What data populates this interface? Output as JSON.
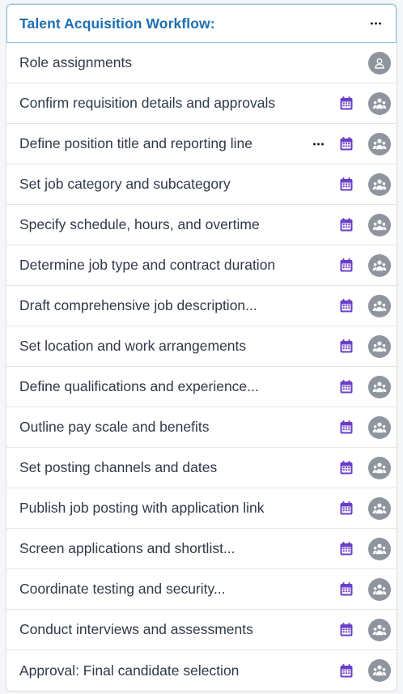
{
  "workflow": {
    "title": "Talent Acquisition Workflow:",
    "role_assignments_label": "Role assignments",
    "steps": [
      {
        "label": "Confirm requisition details and approvals"
      },
      {
        "label": "Define position title and reporting line",
        "more_menu": true
      },
      {
        "label": "Set job category and subcategory"
      },
      {
        "label": "Specify schedule, hours, and overtime"
      },
      {
        "label": "Determine job type and contract duration"
      },
      {
        "label": "Draft comprehensive job description..."
      },
      {
        "label": "Set location and work arrangements"
      },
      {
        "label": "Define qualifications and experience..."
      },
      {
        "label": "Outline pay scale and benefits"
      },
      {
        "label": "Set posting channels and dates"
      },
      {
        "label": "Publish job posting with application link"
      },
      {
        "label": "Screen applications and shortlist..."
      },
      {
        "label": "Coordinate testing and security..."
      },
      {
        "label": "Conduct interviews and assessments"
      },
      {
        "label": "Approval: Final candidate selection"
      }
    ]
  },
  "icons": {
    "header_menu": "more-horizontal-icon",
    "role": "user-icon",
    "due_date": "calendar-icon",
    "assignees": "users-group-icon"
  },
  "colors": {
    "title": "#1f6fb2",
    "calendar": "#6a3fc8",
    "avatar_bg": "#8e959e",
    "header_border": "#8fc4e3"
  }
}
